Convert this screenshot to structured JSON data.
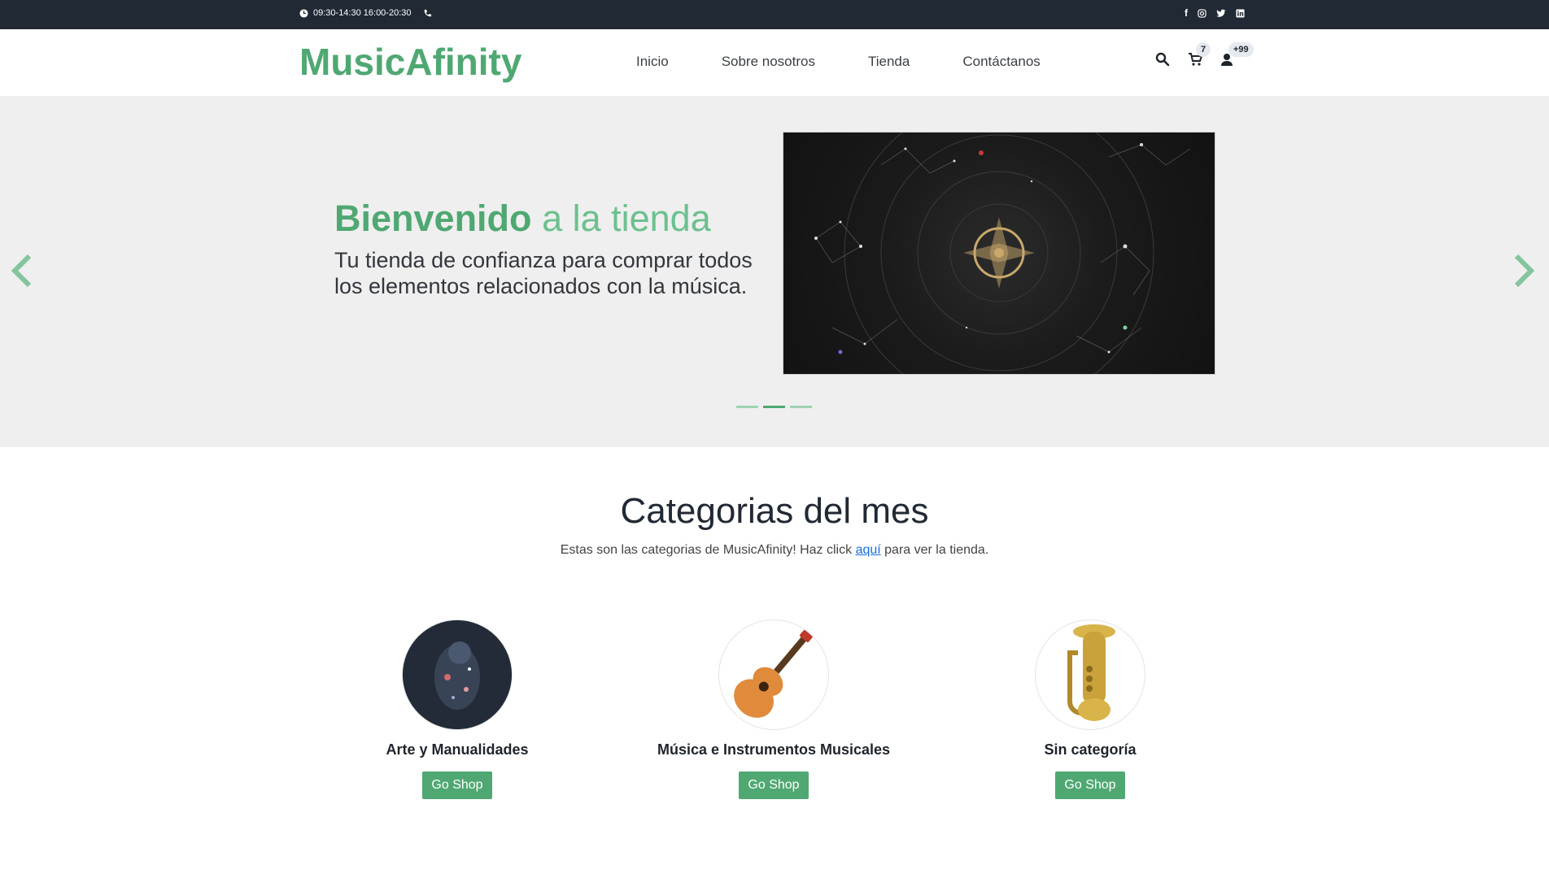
{
  "topbar": {
    "hours": "09:30-14:30 16:00-20:30",
    "icons": [
      "clock-icon",
      "phone-icon",
      "facebook-icon",
      "instagram-icon",
      "twitter-icon",
      "linkedin-icon"
    ]
  },
  "header": {
    "brand": "MusicAfinity",
    "nav": [
      "Inicio",
      "Sobre nosotros",
      "Tienda",
      "Contáctanos"
    ],
    "cart_count": "7",
    "user_count": "+99"
  },
  "hero": {
    "title_strong": "Bienvenido",
    "title_light": "a la tienda",
    "subtitle": "Tu tienda de confianza para comprar todos los elementos relacionados con la música.",
    "prev_label": "‹",
    "next_label": "›"
  },
  "categories": {
    "title": "Categorias del mes",
    "sub_before": "Estas son las categorias de MusicAfinity! Haz click ",
    "sub_link": "aquí",
    "sub_after": " para ver la tienda.",
    "items": [
      {
        "name": "Arte y Manualidades",
        "button": "Go Shop"
      },
      {
        "name": "Música e Instrumentos Musicales",
        "button": "Go Shop"
      },
      {
        "name": "Sin categoría",
        "button": "Go Shop"
      }
    ]
  },
  "colors": {
    "accent": "#4fa872",
    "topbar": "#212934",
    "hero_bg": "#efefef"
  }
}
